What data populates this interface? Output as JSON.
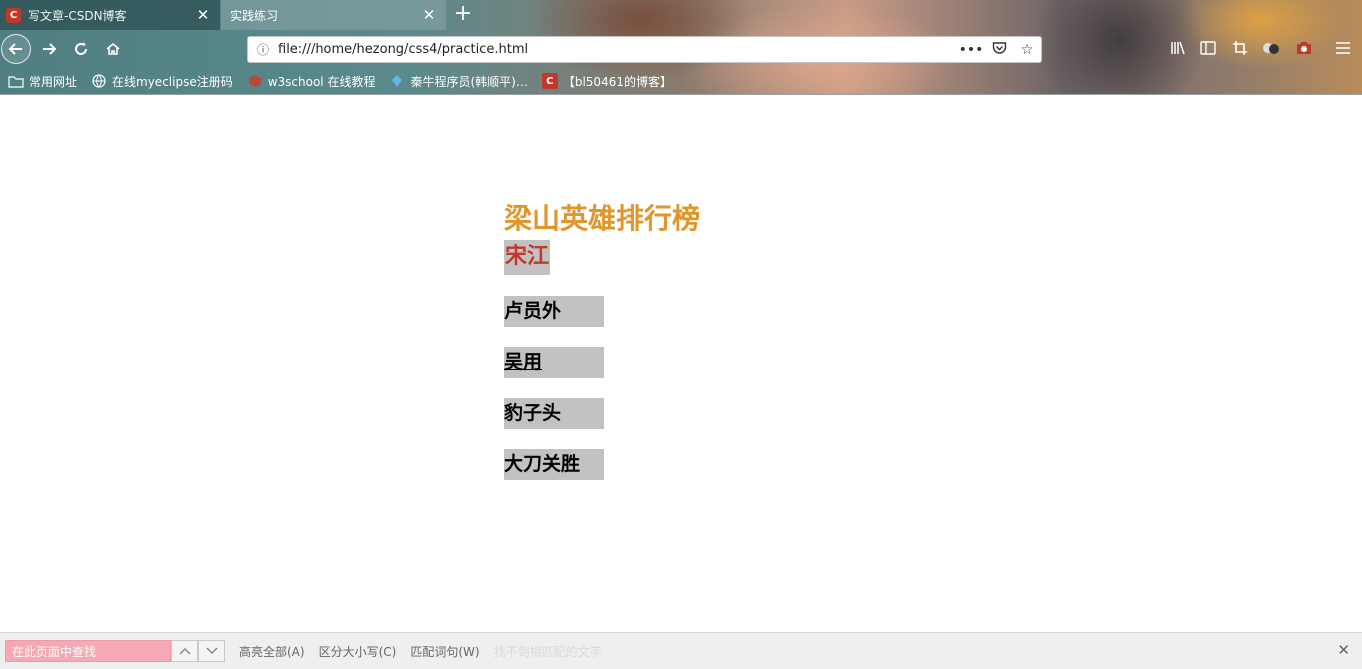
{
  "browser": {
    "tabs": [
      {
        "title": "写文章-CSDN博客",
        "favicon": "C",
        "close": "✕",
        "active": false
      },
      {
        "title": "实践练习",
        "close": "✕",
        "active": true
      }
    ],
    "new_tab": "+",
    "url": "file:///home/hezong/css4/practice.html",
    "bookmarks": [
      {
        "label": "常用网址",
        "icon": "folder-icon"
      },
      {
        "label": "在线myeclipse注册码",
        "icon": "globe-icon"
      },
      {
        "label": "w3school 在线教程",
        "icon": "w3school-icon"
      },
      {
        "label": "秦牛程序员(韩顺平)…",
        "icon": "diamond-icon"
      },
      {
        "label": "【bl50461的博客】",
        "icon": "csdn-icon",
        "favicon": "C"
      }
    ],
    "colors": {
      "csdn_red": "#c0392b"
    }
  },
  "page": {
    "title": "梁山英雄排行榜",
    "first_hero": "宋江",
    "heroes": [
      "卢员外",
      "吴用",
      "豹子头",
      "大刀关胜"
    ],
    "colors": {
      "title": "#e0962c",
      "first_hero": "#c0392b",
      "hero_bg": "#c2c2c2"
    }
  },
  "findbar": {
    "placeholder": "在此页面中查找",
    "highlight_all": "高亮全部(A)",
    "match_case": "区分大小写(C)",
    "whole_words": "匹配词句(W)",
    "status": "找不到相匹配的文字",
    "close": "✕"
  }
}
